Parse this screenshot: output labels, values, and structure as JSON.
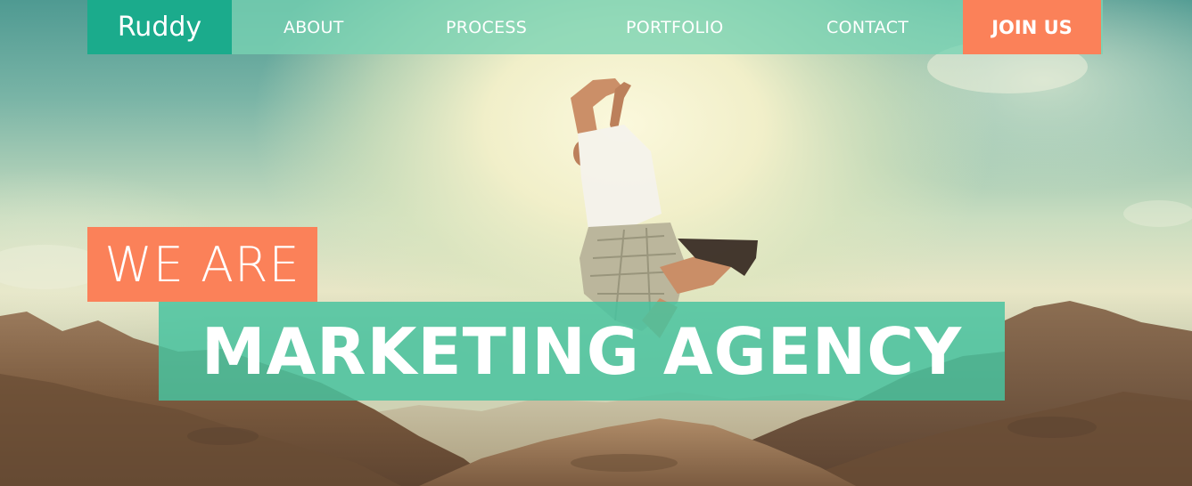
{
  "brand": {
    "name": "Ruddy"
  },
  "nav": {
    "items": [
      {
        "label": "ABOUT"
      },
      {
        "label": "PROCESS"
      },
      {
        "label": "PORTFOLIO"
      },
      {
        "label": "CONTACT"
      }
    ],
    "cta_label": "JOIN US"
  },
  "hero": {
    "line1": "WE ARE",
    "line2": "MARKETING AGENCY"
  },
  "colors": {
    "nav_bg": "#78d4b4",
    "brand_bg": "#1bab8c",
    "accent_orange": "#fb8159",
    "headline_teal": "#48c4a0"
  },
  "image": {
    "subject": "hero-background-photo"
  }
}
